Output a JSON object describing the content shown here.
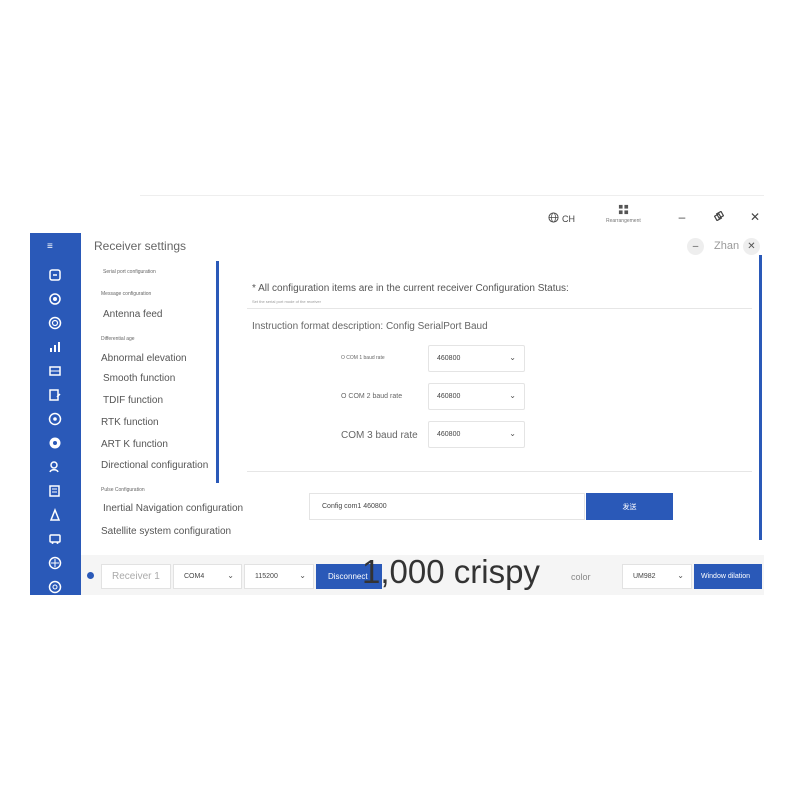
{
  "titlebar": {
    "language": "CH",
    "rearrange_label": "Rearrangement",
    "min_icon": "minimize-icon",
    "restore_icon": "restore-icon",
    "close_icon": "close-icon"
  },
  "panel": {
    "title": "Receiver settings",
    "user": "Zhan"
  },
  "menu": {
    "items": [
      "Serial port configuration",
      "Message configuration",
      "Antenna feed",
      "Differential age",
      "Abnormal elevation",
      "Smooth function",
      "TDIF function",
      "RTK function",
      "ART K function",
      "Directional configuration",
      "Pulse Configuration",
      "Inertial Navigation configuration",
      "Satellite system configuration"
    ]
  },
  "content": {
    "note": "* All configuration items are in the current receiver Configuration Status:",
    "note_sub": "Set the serial port mode of the receiver",
    "format_desc": "Instruction format description: Config SerialPort Baud",
    "baud_rows": [
      {
        "label": "O COM 1 baud rate",
        "value": "460800"
      },
      {
        "label": "O COM 2 baud rate",
        "value": "460800"
      },
      {
        "label": "COM 3 baud rate",
        "value": "460800"
      }
    ],
    "command": "Config com1 460800",
    "send_label": "发送"
  },
  "bottombar": {
    "receiver": "Receiver 1",
    "port": "COM4",
    "baud": "115200",
    "connect_label": "Disconnect",
    "color_label": "color",
    "model": "UM982",
    "window_label": "Window dilation"
  },
  "caption": "1,000 crispy",
  "colors": {
    "accent": "#2a59b8"
  }
}
